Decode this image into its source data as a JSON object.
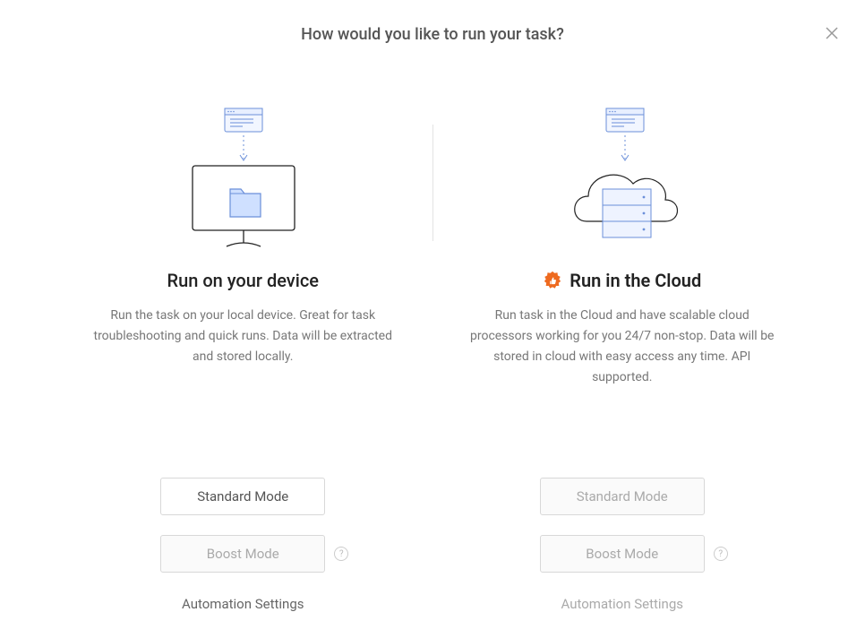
{
  "header": {
    "title": "How would you like to run your task?"
  },
  "device": {
    "title": "Run on your device",
    "description": "Run the task on your local device. Great for task troubleshooting and quick runs. Data will be extracted and stored locally.",
    "standard_label": "Standard Mode",
    "boost_label": "Boost Mode",
    "automation_label": "Automation Settings"
  },
  "cloud": {
    "title": "Run in the Cloud",
    "description": "Run task in the Cloud and have scalable cloud processors working for you 24/7 non-stop. Data will be stored in cloud with easy access any time. API supported.",
    "standard_label": "Standard Mode",
    "boost_label": "Boost Mode",
    "automation_label": "Automation Settings"
  },
  "icons": {
    "close": "close-icon",
    "help": "?",
    "thumbs_up": "thumbs-up-icon"
  },
  "colors": {
    "accent_orange": "#ee6a1f",
    "illus_blue_stroke": "#6b8fd9",
    "illus_blue_fill": "#e8efff"
  }
}
